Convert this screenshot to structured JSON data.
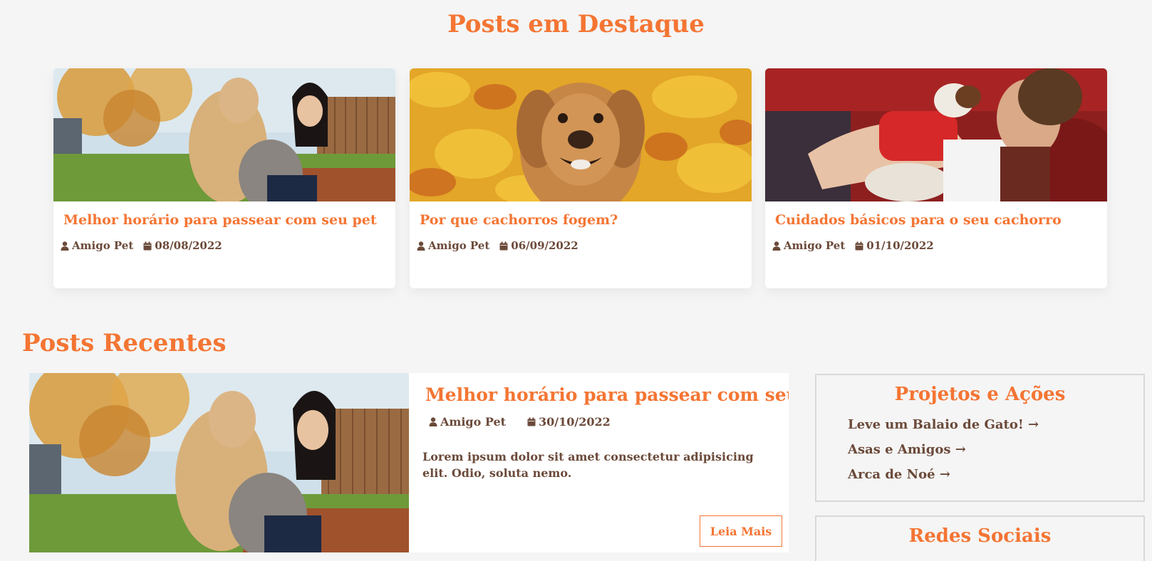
{
  "featured": {
    "title": "Posts em Destaque",
    "posts": [
      {
        "title": "Melhor horário para passear com seu pet",
        "author": "Amigo Pet",
        "date": "08/08/2022"
      },
      {
        "title": "Por que cachorros fogem?",
        "author": "Amigo Pet",
        "date": "06/09/2022"
      },
      {
        "title": "Cuidados básicos para o seu cachorro",
        "author": "Amigo Pet",
        "date": "01/10/2022"
      }
    ]
  },
  "recent": {
    "title": "Posts Recentes",
    "post": {
      "title": "Melhor horário para passear com seu pet",
      "author": "Amigo Pet",
      "date": "30/10/2022",
      "excerpt": "Lorem ipsum dolor sit amet consectetur adipisicing elit. Odio, soluta nemo.",
      "read_more": "Leia Mais"
    }
  },
  "sidebar": {
    "projects": {
      "title": "Projetos e Ações",
      "items": [
        {
          "label": "Leve um Balaio de Gato!",
          "arrow": "→"
        },
        {
          "label": "Asas e Amigos",
          "arrow": "→"
        },
        {
          "label": "Arca de Noé",
          "arrow": "→"
        }
      ]
    },
    "social": {
      "title": "Redes Sociais"
    }
  },
  "icons": {
    "author": "user-icon",
    "date": "calendar-icon"
  },
  "colors": {
    "accent": "#f47533",
    "text": "#6b4a3a",
    "background": "#f5f5f5"
  }
}
